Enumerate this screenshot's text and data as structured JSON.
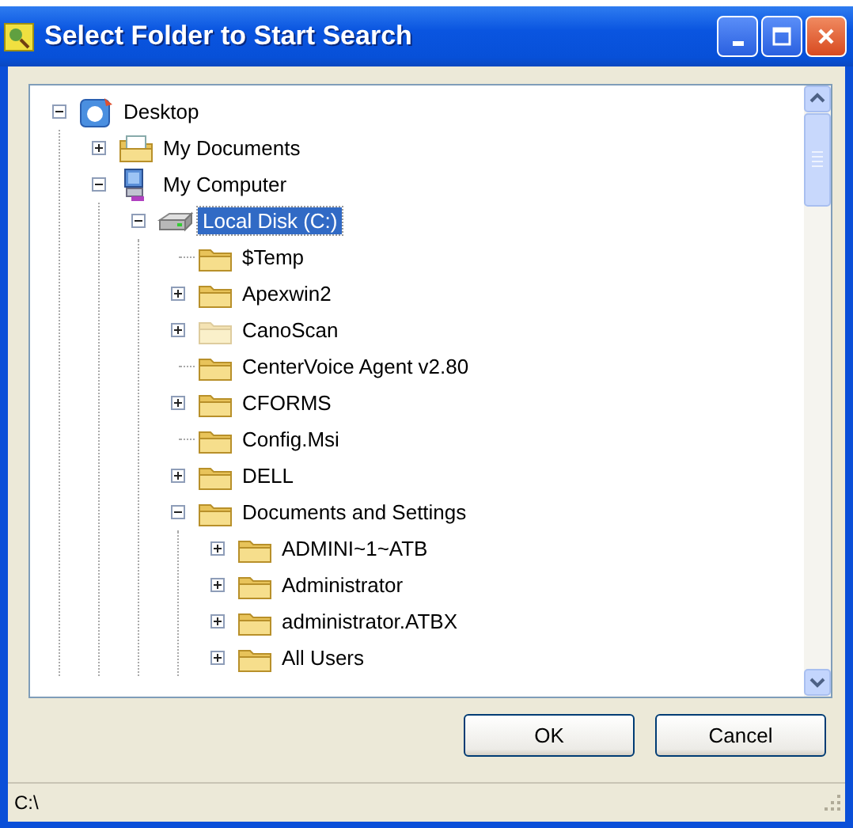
{
  "window": {
    "title": "Select Folder to Start Search"
  },
  "tree": [
    {
      "label": "Desktop",
      "kind": "desktop",
      "expanded": true,
      "selected": false,
      "dimmed": false,
      "children": [
        {
          "label": "My Documents",
          "kind": "documents",
          "expanded": false,
          "selected": false,
          "dimmed": false
        },
        {
          "label": "My Computer",
          "kind": "computer",
          "expanded": true,
          "selected": false,
          "dimmed": false,
          "children": [
            {
              "label": "Local Disk (C:)",
              "kind": "drive",
              "expanded": true,
              "selected": true,
              "dimmed": false,
              "children": [
                {
                  "label": "$Temp",
                  "kind": "folder",
                  "selected": false,
                  "dimmed": false
                },
                {
                  "label": "Apexwin2",
                  "kind": "folder",
                  "expanded": false,
                  "selected": false,
                  "dimmed": false
                },
                {
                  "label": "CanoScan",
                  "kind": "folder",
                  "expanded": false,
                  "selected": false,
                  "dimmed": true
                },
                {
                  "label": "CenterVoice Agent v2.80",
                  "kind": "folder",
                  "selected": false,
                  "dimmed": false
                },
                {
                  "label": "CFORMS",
                  "kind": "folder",
                  "expanded": false,
                  "selected": false,
                  "dimmed": false
                },
                {
                  "label": "Config.Msi",
                  "kind": "folder",
                  "selected": false,
                  "dimmed": false
                },
                {
                  "label": "DELL",
                  "kind": "folder",
                  "expanded": false,
                  "selected": false,
                  "dimmed": false
                },
                {
                  "label": "Documents and Settings",
                  "kind": "folder",
                  "expanded": true,
                  "selected": false,
                  "dimmed": false,
                  "children": [
                    {
                      "label": "ADMINI~1~ATB",
                      "kind": "folder",
                      "expanded": false,
                      "selected": false,
                      "dimmed": false
                    },
                    {
                      "label": "Administrator",
                      "kind": "folder",
                      "expanded": false,
                      "selected": false,
                      "dimmed": false
                    },
                    {
                      "label": "administrator.ATBX",
                      "kind": "folder",
                      "expanded": false,
                      "selected": false,
                      "dimmed": false
                    },
                    {
                      "label": "All Users",
                      "kind": "folder",
                      "expanded": false,
                      "selected": false,
                      "dimmed": false
                    }
                  ]
                }
              ]
            }
          ]
        }
      ]
    }
  ],
  "buttons": [
    "OK",
    "Cancel"
  ],
  "status_bar": "C:\\"
}
